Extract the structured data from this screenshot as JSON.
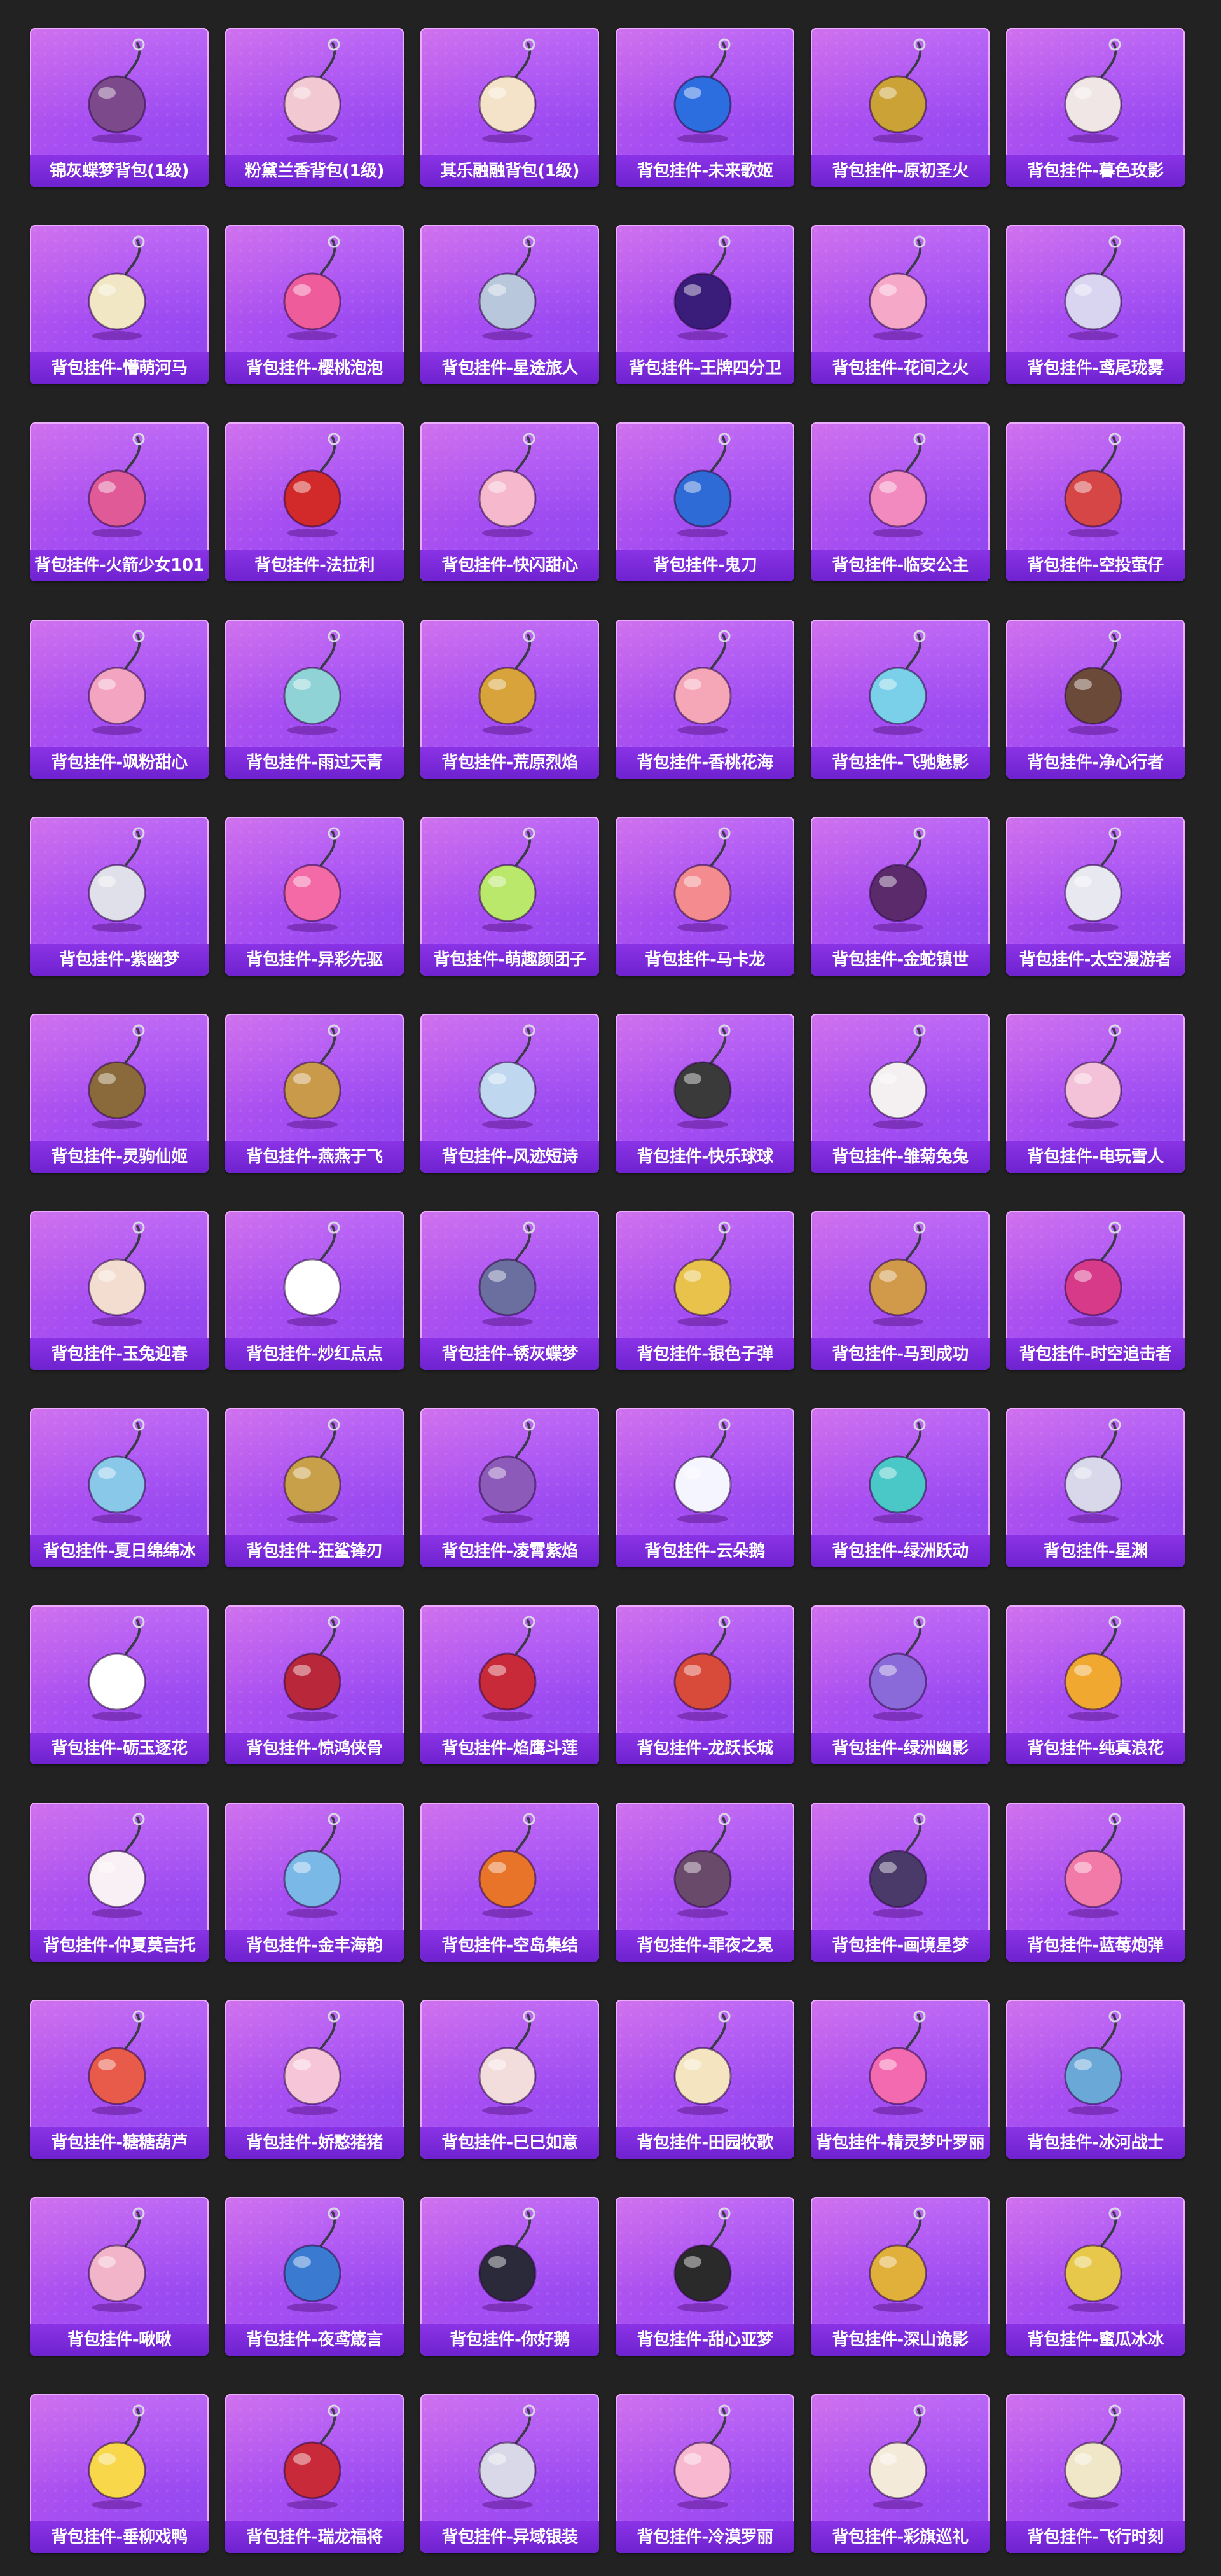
{
  "colors": {
    "page_background": "#222222",
    "card_gradient_start": "#c05be8",
    "card_gradient_end": "#8f46f0",
    "label_background": "#7a2bd9",
    "label_text": "#ffffff"
  },
  "items": [
    {
      "label": "锦灰蝶梦背包(1级)",
      "icon": "purple-bow-backpack-icon",
      "color": "#7c4a8a"
    },
    {
      "label": "粉黛兰香背包(1级)",
      "icon": "pink-bunny-backpack-icon",
      "color": "#f2c8d2"
    },
    {
      "label": "其乐融融背包(1级)",
      "icon": "cream-bunny-backpack-icon",
      "color": "#f4e3c8"
    },
    {
      "label": "背包挂件-未来歌姬",
      "icon": "blue-heart-charm-icon",
      "color": "#2c6de0"
    },
    {
      "label": "背包挂件-原初圣火",
      "icon": "golden-emblem-charm-icon",
      "color": "#caa236"
    },
    {
      "label": "背包挂件-暮色玫影",
      "icon": "winged-badge-charm-icon",
      "color": "#f0e6e6"
    },
    {
      "label": "背包挂件-懵萌河马",
      "icon": "hippo-tail-charm-icon",
      "color": "#f1e7c4"
    },
    {
      "label": "背包挂件-樱桃泡泡",
      "icon": "cherry-heart-charm-icon",
      "color": "#ef5c9b"
    },
    {
      "label": "背包挂件-星途旅人",
      "icon": "rocket-charm-icon",
      "color": "#b9c7dc"
    },
    {
      "label": "背包挂件-王牌四分卫",
      "icon": "purple-football-charm-icon",
      "color": "#3a1d7a"
    },
    {
      "label": "背包挂件-花间之火",
      "icon": "pink-lantern-charm-icon",
      "color": "#f5a8c8"
    },
    {
      "label": "背包挂件-鸢尾珑雾",
      "icon": "iris-flower-charm-icon",
      "color": "#d9d4ef"
    },
    {
      "label": "背包挂件-火箭少女101",
      "icon": "pink-shark-charm-icon",
      "color": "#e05a97"
    },
    {
      "label": "背包挂件-法拉利",
      "icon": "ferrari-shield-charm-icon",
      "color": "#d22a2a"
    },
    {
      "label": "背包挂件-快闪甜心",
      "icon": "pink-donut-charm-icon",
      "color": "#f5b8cc"
    },
    {
      "label": "背包挂件-鬼刀",
      "icon": "blue-crystal-charm-icon",
      "color": "#2f6bd6"
    },
    {
      "label": "背包挂件-临安公主",
      "icon": "butterfly-charm-icon",
      "color": "#f28ac0"
    },
    {
      "label": "背包挂件-空投萤仔",
      "icon": "red-airdrop-charm-icon",
      "color": "#d64646"
    },
    {
      "label": "背包挂件-飒粉甜心",
      "icon": "pink-abacus-charm-icon",
      "color": "#f2a4c1"
    },
    {
      "label": "背包挂件-雨过天青",
      "icon": "celadon-stick-charm-icon",
      "color": "#8fd3d6"
    },
    {
      "label": "背包挂件-荒原烈焰",
      "icon": "golden-sun-charm-icon",
      "color": "#d8a33a"
    },
    {
      "label": "背包挂件-香桃花海",
      "icon": "peach-blossom-charm-icon",
      "color": "#f5a7b8"
    },
    {
      "label": "背包挂件-飞驰魅影",
      "icon": "winged-eye-charm-icon",
      "color": "#7ad0e8"
    },
    {
      "label": "背包挂件-净心行者",
      "icon": "dark-staff-charm-icon",
      "color": "#6b4a3a"
    },
    {
      "label": "背包挂件-紫幽梦",
      "icon": "silver-bell-charm-icon",
      "color": "#e0e0ea"
    },
    {
      "label": "背包挂件-异彩先驱",
      "icon": "roller-skate-charm-icon",
      "color": "#f46aa6"
    },
    {
      "label": "背包挂件-萌趣颜团子",
      "icon": "green-dumpling-charm-icon",
      "color": "#b9e86a"
    },
    {
      "label": "背包挂件-马卡龙",
      "icon": "macaron-charm-icon",
      "color": "#f38b8f"
    },
    {
      "label": "背包挂件-金蛇镇世",
      "icon": "golden-snake-charm-icon",
      "color": "#5a2a6a"
    },
    {
      "label": "背包挂件-太空漫游者",
      "icon": "astronaut-charm-icon",
      "color": "#e8e8f0"
    },
    {
      "label": "背包挂件-灵驹仙姬",
      "icon": "golden-horse-charm-icon",
      "color": "#8a6a3a"
    },
    {
      "label": "背包挂件-燕燕于飞",
      "icon": "golden-swallow-charm-icon",
      "color": "#c89a4a"
    },
    {
      "label": "背包挂件-风迹短诗",
      "icon": "crystal-shard-charm-icon",
      "color": "#bfd8ef"
    },
    {
      "label": "背包挂件-快乐球球",
      "icon": "dark-ball-charm-icon",
      "color": "#3a3a3a"
    },
    {
      "label": "背包挂件-雏菊兔兔",
      "icon": "daisy-bunny-charm-icon",
      "color": "#f4eff0"
    },
    {
      "label": "背包挂件-电玩雪人",
      "icon": "gameboy-charm-icon",
      "color": "#f4c2d8"
    },
    {
      "label": "背包挂件-玉兔迎春",
      "icon": "jade-rabbit-charm-icon",
      "color": "#f2ddd0"
    },
    {
      "label": "背包挂件-炒红点点",
      "icon": "white-daisy-charm-icon",
      "color": "#ffffff"
    },
    {
      "label": "背包挂件-锈灰蝶梦",
      "icon": "axe-charm-icon",
      "color": "#6a6fa0"
    },
    {
      "label": "背包挂件-银色子弹",
      "icon": "gold-phone-charm-icon",
      "color": "#e8c24a"
    },
    {
      "label": "背包挂件-马到成功",
      "icon": "rocking-horse-charm-icon",
      "color": "#d19a4a"
    },
    {
      "label": "背包挂件-时空追击者",
      "icon": "pink-crest-charm-icon",
      "color": "#d83a8a"
    },
    {
      "label": "背包挂件-夏日绵绵冰",
      "icon": "ice-cream-charm-icon",
      "color": "#8ac8ea"
    },
    {
      "label": "背包挂件-狂鲨锋刃",
      "icon": "golden-blade-charm-icon",
      "color": "#c8a04a"
    },
    {
      "label": "背包挂件-凌霄紫焰",
      "icon": "purple-flame-charm-icon",
      "color": "#8c5ab8"
    },
    {
      "label": "背包挂件-云朵鹅",
      "icon": "cloud-goose-charm-icon",
      "color": "#f5f5ff"
    },
    {
      "label": "背包挂件-绿洲跃动",
      "icon": "teal-shoe-charm-icon",
      "color": "#4ac8c8"
    },
    {
      "label": "背包挂件-星渊",
      "icon": "silver-chain-charm-icon",
      "color": "#d8d8ea"
    },
    {
      "label": "背包挂件-砺玉逐花",
      "icon": "panda-badge-charm-icon",
      "color": "#ffffff"
    },
    {
      "label": "背包挂件-惊鸿侠骨",
      "icon": "red-tassel-charm-icon",
      "color": "#b8283a"
    },
    {
      "label": "背包挂件-焰鹰斗莲",
      "icon": "red-knot-charm-icon",
      "color": "#c82a3a"
    },
    {
      "label": "背包挂件-龙跃长城",
      "icon": "dragon-mask-charm-icon",
      "color": "#d84a3a"
    },
    {
      "label": "背包挂件-绿洲幽影",
      "icon": "violet-gem-charm-icon",
      "color": "#8a6ad8"
    },
    {
      "label": "背包挂件-纯真浪花",
      "icon": "orange-bottle-opener-charm-icon",
      "color": "#f0a830"
    },
    {
      "label": "背包挂件-仲夏莫吉托",
      "icon": "white-blossom-charm-icon",
      "color": "#f8f0f4"
    },
    {
      "label": "背包挂件-金丰海韵",
      "icon": "blue-scroll-charm-icon",
      "color": "#7ab8e8"
    },
    {
      "label": "背包挂件-空岛集结",
      "icon": "orange-gun-charm-icon",
      "color": "#e8742a"
    },
    {
      "label": "背包挂件-罪夜之冕",
      "icon": "bat-heart-charm-icon",
      "color": "#6a4a6a"
    },
    {
      "label": "背包挂件-画境星梦",
      "icon": "bow-brooch-charm-icon",
      "color": "#4a3a6a"
    },
    {
      "label": "背包挂件-蓝莓炮弹",
      "icon": "pink-cone-charm-icon",
      "color": "#f27aa8"
    },
    {
      "label": "背包挂件-糖糖葫芦",
      "icon": "gourd-charm-icon",
      "color": "#e85a4a"
    },
    {
      "label": "背包挂件-娇憨猪猪",
      "icon": "pink-pig-charm-icon",
      "color": "#f6c6d8"
    },
    {
      "label": "背包挂件-巳巳如意",
      "icon": "snake-doll-charm-icon",
      "color": "#f2dcdc"
    },
    {
      "label": "背包挂件-田园牧歌",
      "icon": "photo-card-charm-icon",
      "color": "#f4e4c0"
    },
    {
      "label": "背包挂件-精灵梦叶罗丽",
      "icon": "winged-heart-charm-icon",
      "color": "#f46ab0"
    },
    {
      "label": "背包挂件-冰河战士",
      "icon": "robot-charm-icon",
      "color": "#6aa8d8"
    },
    {
      "label": "背包挂件-啾啾",
      "icon": "pink-cat-charm-icon",
      "color": "#f2b4c8"
    },
    {
      "label": "背包挂件-夜鸢箴言",
      "icon": "blue-lily-charm-icon",
      "color": "#3a7ad0"
    },
    {
      "label": "背包挂件-你好鹅",
      "icon": "penguin-charm-icon",
      "color": "#2a2a3a"
    },
    {
      "label": "背包挂件-甜心亚梦",
      "icon": "paw-charm-icon",
      "color": "#2a2a2a"
    },
    {
      "label": "背包挂件-深山诡影",
      "icon": "golden-scroll-charm-icon",
      "color": "#e0b03a"
    },
    {
      "label": "背包挂件-蜜瓜冰冰",
      "icon": "melon-tag-charm-icon",
      "color": "#e8c84a"
    },
    {
      "label": "背包挂件-垂柳戏鸭",
      "icon": "yellow-duck-charm-icon",
      "color": "#f8d84a"
    },
    {
      "label": "背包挂件-瑞龙福将",
      "icon": "red-lantern-charm-icon",
      "color": "#c82a3a"
    },
    {
      "label": "背包挂件-异域银装",
      "icon": "silver-wings-charm-icon",
      "color": "#d8d8e8"
    },
    {
      "label": "背包挂件-冷漠罗丽",
      "icon": "pink-flower-charm-icon",
      "color": "#f8b8d0"
    },
    {
      "label": "背包挂件-彩旗巡礼",
      "icon": "soft-serve-charm-icon",
      "color": "#f4eada"
    },
    {
      "label": "背包挂件-飞行时刻",
      "icon": "airplane-charm-icon",
      "color": "#f0e6c8"
    }
  ]
}
